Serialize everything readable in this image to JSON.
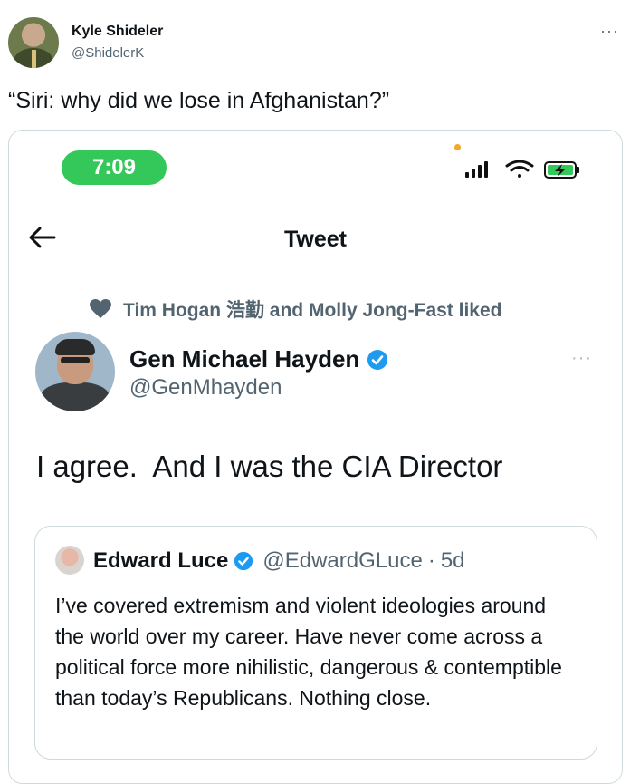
{
  "outer_tweet": {
    "author_name": "Kyle Shideler",
    "author_handle": "@ShidelerK",
    "more": "···",
    "text": "“Siri: why did we lose in Afghanistan?”"
  },
  "screenshot": {
    "status_bar": {
      "time": "7:09"
    },
    "header": {
      "title": "Tweet"
    },
    "liked_by": "Tim Hogan 浩勤 and Molly Jong-Fast liked",
    "tweet": {
      "author_name": "Gen Michael Hayden",
      "author_handle": "@GenMhayden",
      "more": "···",
      "text": "I agree.  And I was the CIA Director"
    },
    "quoted": {
      "author_name": "Edward Luce",
      "author_handle": "@EdwardGLuce",
      "separator": "·",
      "age": "5d",
      "text": "I’ve covered extremism and violent ideologies around the world over my career. Have never come across a political force more nihilistic, dangerous & contemptible than today’s Republicans. Nothing close."
    }
  },
  "colors": {
    "verified": "#1d9bf0",
    "time_pill": "#34c759",
    "secondary_text": "#536471"
  },
  "icons": [
    "more-icon",
    "signal-icon",
    "wifi-icon",
    "battery-charging-icon",
    "back-arrow-icon",
    "heart-icon",
    "verified-icon"
  ]
}
